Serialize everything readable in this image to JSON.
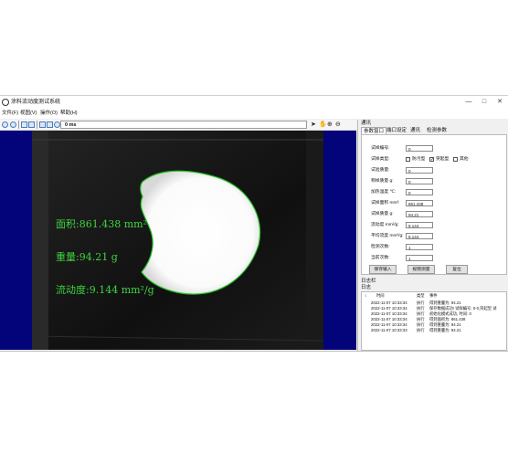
{
  "window": {
    "title": "涂料流动度测试系统",
    "controls": [
      "—",
      "□",
      "✕"
    ]
  },
  "menu": [
    "文件(F)",
    "视图(V)",
    "操作(O)",
    "帮助(H)"
  ],
  "toolbar": {
    "zoom_value": "0 ms",
    "tool_icons": [
      "pointer-icon",
      "hand-icon",
      "zoom-in-icon",
      "zoom-out-icon"
    ]
  },
  "measurements": {
    "area": "面积:861.438 mm²",
    "weight": "重量:94.21 g",
    "fluidity": "流动度:9.144 mm²/g"
  },
  "panel": {
    "header": "通讯",
    "tabs": [
      "参数窗口",
      "端口设定",
      "通讯",
      "检测参数"
    ],
    "active_tab": 0,
    "fields": [
      {
        "label": "试样编号:",
        "value": "0"
      },
      {
        "label": "试样类型:",
        "value": ""
      },
      {
        "label": "试验质量:",
        "value": "0"
      },
      {
        "label": "称样质量 g:",
        "value": "0"
      },
      {
        "label": "加热温度 ℃:",
        "value": "0"
      },
      {
        "label": "试样面积 mm²:",
        "value": "861.438"
      },
      {
        "label": "试样质量 g:",
        "value": "94.21"
      },
      {
        "label": "流动度 mm²/g:",
        "value": "9.144"
      },
      {
        "label": "平均流度 mm²/g:",
        "value": "9.144"
      },
      {
        "label": "检测次数:",
        "value": "1"
      },
      {
        "label": "当前次数:",
        "value": "1"
      }
    ],
    "type_options": [
      {
        "label": "防污型",
        "checked": false
      },
      {
        "label": "突起型",
        "checked": true
      },
      {
        "label": "其他",
        "checked": false
      }
    ],
    "buttons": [
      "保存输入",
      "视频测量",
      "复位"
    ]
  },
  "log": {
    "header": "日志栏",
    "subheader": "日志",
    "columns": [
      "时间",
      "类型",
      "事件"
    ],
    "rows": [
      {
        "time": "2022-11-07 10:33:34",
        "type": "执行",
        "event": "得到重量为: 94.21"
      },
      {
        "time": "2022-11-07 10:33:34",
        "type": "执行",
        "event": "保存数据成功! 试样编号: 0-0,突起型 试"
      },
      {
        "time": "2022-11-07 10:33:34",
        "type": "执行",
        "event": "初始化模式成功, 时间: 0"
      },
      {
        "time": "2022-11-07 10:33:34",
        "type": "执行",
        "event": "得到面积为: 861.438"
      },
      {
        "time": "2022-11-07 10:33:34",
        "type": "执行",
        "event": "得到重量为: 94.21"
      },
      {
        "time": "2022-11-07 10:33:33",
        "type": "执行",
        "event": "得到重量为: 94.21"
      }
    ]
  },
  "colors": {
    "viewer_background": "#03037a",
    "measurement_text": "#3fd43f",
    "contour": "#27c427"
  }
}
